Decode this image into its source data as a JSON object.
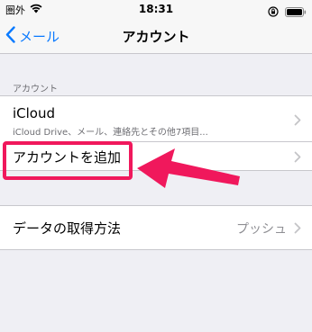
{
  "status_bar": {
    "carrier": "圏外",
    "time": "18:31",
    "icons": [
      "wifi-icon",
      "rotation-lock-icon",
      "battery-icon"
    ]
  },
  "nav": {
    "back_label": "メール",
    "title": "アカウント"
  },
  "accounts_section": {
    "header": "アカウント",
    "items": [
      {
        "title": "iCloud",
        "subtitle": "iCloud Drive、メール、連絡先とその他7項目..."
      },
      {
        "title": "アカウントを追加"
      }
    ]
  },
  "fetch_section": {
    "label": "データの取得方法",
    "value": "プッシュ"
  },
  "annotation": {
    "color": "#f0185c"
  },
  "colors": {
    "accent": "#0a7aff",
    "background": "#efeff4",
    "separator": "#c8c7cc",
    "secondary_text": "#6d6d72",
    "value_text": "#8e8e93"
  }
}
